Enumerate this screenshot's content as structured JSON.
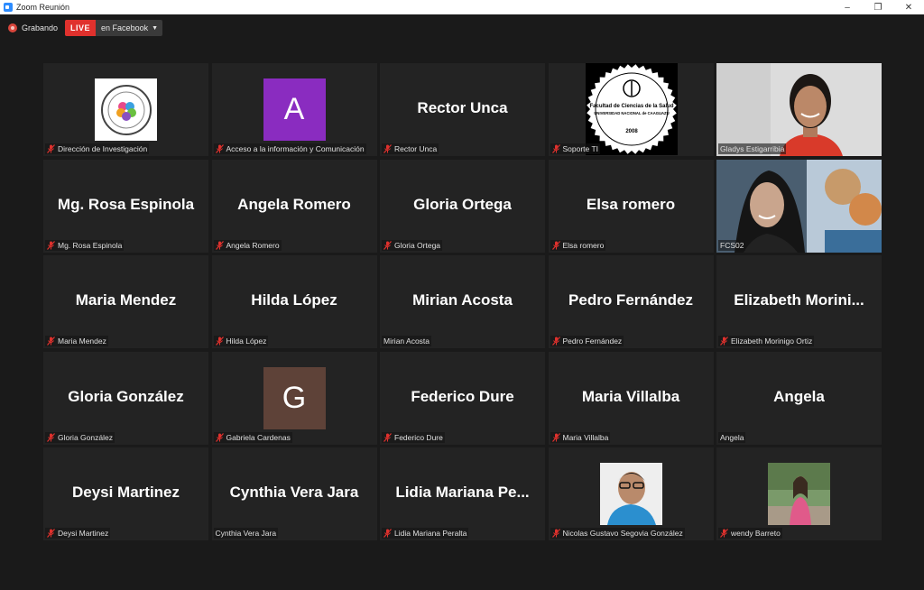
{
  "window": {
    "title": "Zoom Reunión",
    "minimize": "–",
    "maximize": "❐",
    "close": "✕"
  },
  "recording": {
    "label": "Grabando",
    "live_badge": "LIVE",
    "live_target": "en Facebook",
    "caret": "▼"
  },
  "colors": {
    "background": "#1a1a1a",
    "tile": "#232323",
    "active_speaker": "#e6e268",
    "live": "#e0312d",
    "mute": "#e0312d"
  },
  "participants": [
    {
      "display": "",
      "label": "Dirección de Investigación",
      "muted": true,
      "avatar": "logo-circular-seal"
    },
    {
      "display": "A",
      "label": "Acceso a la información y Comunicación",
      "muted": true,
      "avatar": "letter",
      "avatar_color": "#8a2cc0"
    },
    {
      "display": "Rector Unca",
      "label": "Rector Unca",
      "muted": true,
      "avatar": "none"
    },
    {
      "display": "",
      "label": "Soporte TI",
      "muted": true,
      "avatar": "logo-faculty-seal",
      "logo_text": [
        "Facultad de Ciencias de la Salud",
        "UNIVERSIDAD NACIONAL de CAAGUAZÚ",
        "2008"
      ]
    },
    {
      "display": "",
      "label": "Gladys Estigarribia",
      "muted": false,
      "avatar": "video"
    },
    {
      "display": "Mg. Rosa Espinola",
      "label": "Mg. Rosa Espinola",
      "muted": true,
      "avatar": "none"
    },
    {
      "display": "Angela Romero",
      "label": "Angela Romero",
      "muted": true,
      "avatar": "none"
    },
    {
      "display": "Gloria Ortega",
      "label": "Gloria Ortega",
      "muted": true,
      "avatar": "none"
    },
    {
      "display": "Elsa romero",
      "label": "Elsa romero",
      "muted": true,
      "avatar": "none"
    },
    {
      "display": "",
      "label": "FCS02",
      "muted": false,
      "avatar": "video",
      "active": true
    },
    {
      "display": "Maria Mendez",
      "label": "Maria Mendez",
      "muted": true,
      "avatar": "none"
    },
    {
      "display": "Hilda López",
      "label": "Hilda López",
      "muted": true,
      "avatar": "none"
    },
    {
      "display": "Mirian Acosta",
      "label": "Mirian Acosta",
      "muted": false,
      "avatar": "none"
    },
    {
      "display": "Pedro Fernández",
      "label": "Pedro Fernández",
      "muted": true,
      "avatar": "none"
    },
    {
      "display": "Elizabeth  Morini...",
      "label": "Elizabeth Morinigo Ortiz",
      "muted": true,
      "avatar": "none"
    },
    {
      "display": "Gloria González",
      "label": "Gloria González",
      "muted": true,
      "avatar": "none"
    },
    {
      "display": "G",
      "label": "Gabriela Cardenas",
      "muted": true,
      "avatar": "letter",
      "avatar_color": "#5e4238"
    },
    {
      "display": "Federico Dure",
      "label": "Federico Dure",
      "muted": true,
      "avatar": "none"
    },
    {
      "display": "Maria Villalba",
      "label": "Maria Villalba",
      "muted": true,
      "avatar": "none"
    },
    {
      "display": "Angela",
      "label": "Angela",
      "muted": false,
      "avatar": "none"
    },
    {
      "display": "Deysi Martinez",
      "label": "Deysi Martinez",
      "muted": true,
      "avatar": "none"
    },
    {
      "display": "Cynthia Vera Jara",
      "label": "Cynthia Vera Jara",
      "muted": false,
      "avatar": "none"
    },
    {
      "display": "Lidia  Mariana  Pe...",
      "label": "Lidia Mariana Peralta",
      "muted": true,
      "avatar": "none"
    },
    {
      "display": "",
      "label": "Nicolas Gustavo Segovia González",
      "muted": true,
      "avatar": "photo-man"
    },
    {
      "display": "",
      "label": "wendy Barreto",
      "muted": true,
      "avatar": "photo-woman"
    }
  ]
}
